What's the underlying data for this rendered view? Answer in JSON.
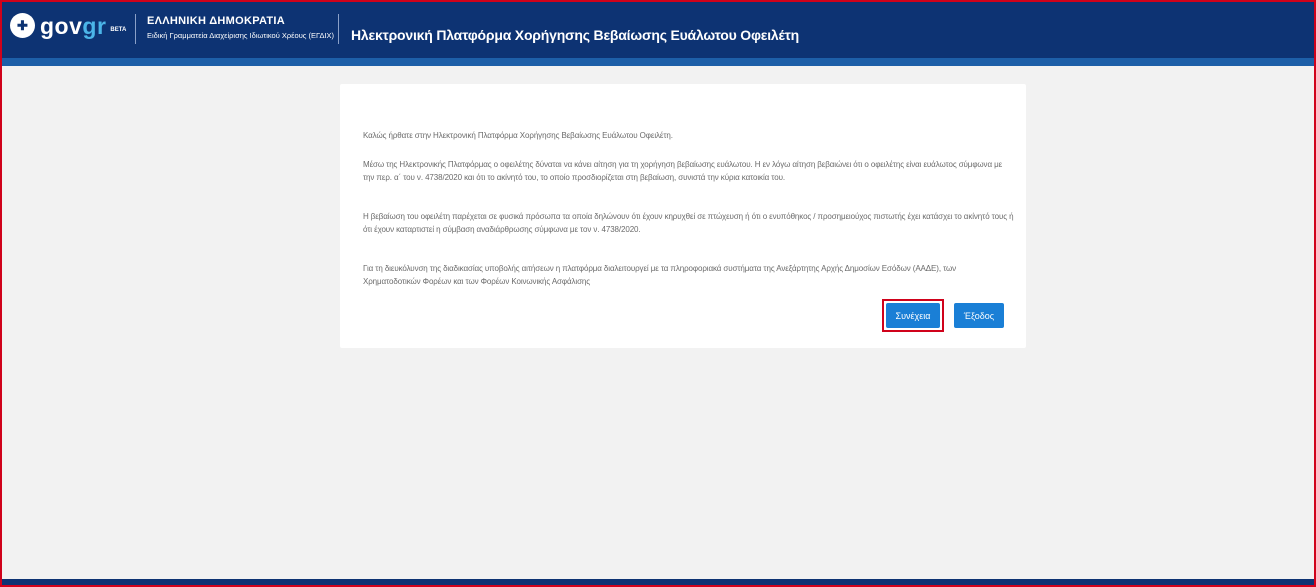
{
  "header": {
    "logo_main": "gov",
    "logo_accent": "gr",
    "logo_badge": "BETA",
    "org_title": "ΕΛΛΗΝΙΚΗ ΔΗΜΟΚΡΑΤΙΑ",
    "org_subtitle": "Ειδική Γραμματεία Διαχείρισης Ιδιωτικού Χρέους (ΕΓΔΙΧ)",
    "app_title": "Ηλεκτρονική Πλατφόρμα Χορήγησης Βεβαίωσης Ευάλωτου Οφειλέτη"
  },
  "card": {
    "paragraphs": [
      "Καλώς ήρθατε στην Ηλεκτρονική Πλατφόρμα Χορήγησης Βεβαίωσης Ευάλωτου Οφειλέτη.",
      "Μέσω της Ηλεκτρονικής Πλατφόρμας ο οφειλέτης δύναται να κάνει αίτηση για τη χορήγηση βεβαίωσης ευάλωτου. Η εν λόγω αίτηση βεβαιώνει ότι ο οφειλέτης είναι ευάλωτος σύμφωνα με την περ. α΄ του ν. 4738/2020 και ότι το ακίνητό του, το οποίο προσδιορίζεται στη βεβαίωση, συνιστά την κύρια κατοικία του.",
      "Η βεβαίωση του οφειλέτη παρέχεται σε φυσικά πρόσωπα τα οποία δηλώνουν ότι έχουν κηρυχθεί σε πτώχευση ή ότι ο ενυπόθηκος / προσημειούχος πιστωτής έχει κατάσχει το ακίνητό τους ή ότι έχουν καταρτιστεί η σύμβαση αναδιάρθρωσης σύμφωνα με τον ν. 4738/2020.",
      "Για τη διευκόλυνση της διαδικασίας υποβολής αιτήσεων η πλατφόρμα διαλειτουργεί με τα πληροφοριακά συστήματα της Ανεξάρτητης Αρχής Δημοσίων Εσόδων (ΑΑΔΕ), των Χρηματοδοτικών Φορέων και των Φορέων Κοινωνικής Ασφάλισης"
    ],
    "continue_label": "Συνέχεια",
    "exit_label": "Έξοδος"
  },
  "colors": {
    "header_bg": "#0d3373",
    "button_bg": "#1a7fd6",
    "highlight": "#d0021b",
    "logo_accent": "#4bb5e8"
  },
  "icons": {
    "emblem": "greek-coat-of-arms-icon"
  }
}
